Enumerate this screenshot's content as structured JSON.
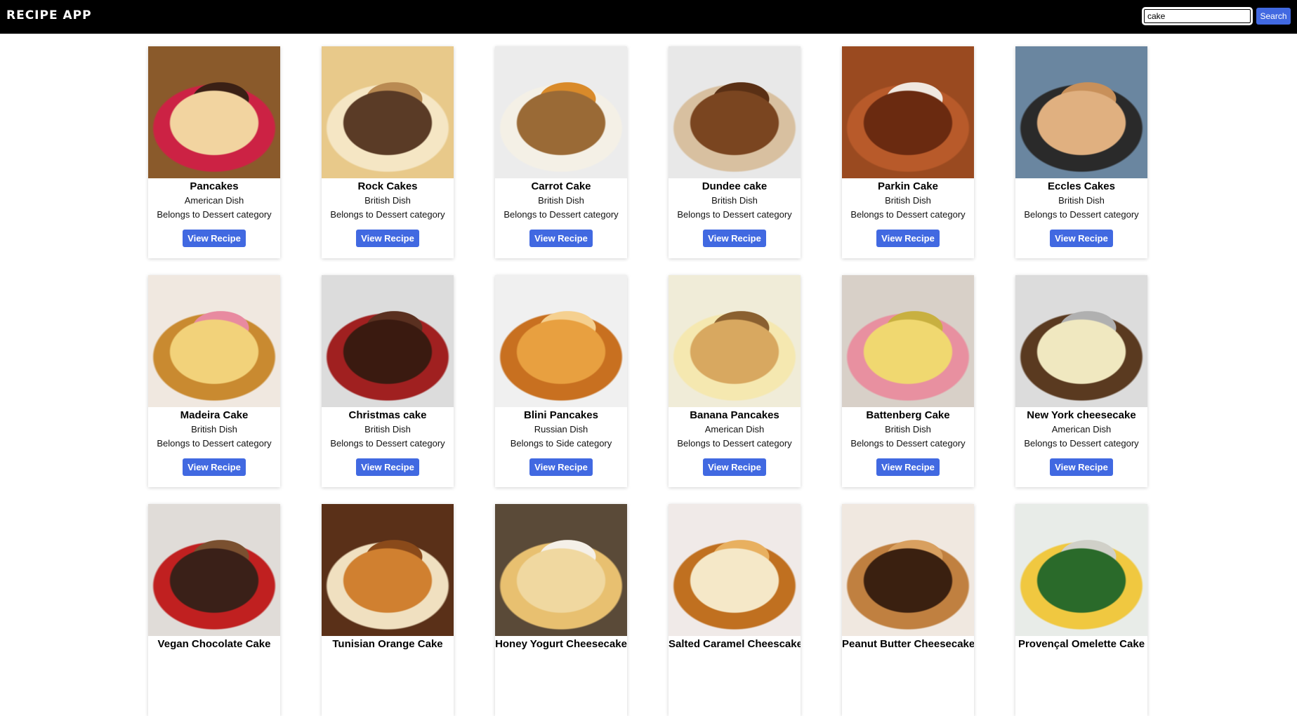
{
  "header": {
    "title": "RECIPE APP",
    "search_value": "cake",
    "search_button": "Search"
  },
  "recipes": [
    {
      "name": "Pancakes",
      "cuisine": "American Dish",
      "category": "Belongs to Dessert category",
      "button": "View Recipe",
      "colors": [
        "#8a5a2b",
        "#f2d4a0",
        "#c24",
        "#3a2015"
      ]
    },
    {
      "name": "Rock Cakes",
      "cuisine": "British Dish",
      "category": "Belongs to Dessert category",
      "button": "View Recipe",
      "colors": [
        "#e8c98a",
        "#5a3b26",
        "#f5e6c4",
        "#b98a52"
      ]
    },
    {
      "name": "Carrot Cake",
      "cuisine": "British Dish",
      "category": "Belongs to Dessert category",
      "button": "View Recipe",
      "colors": [
        "#ececec",
        "#9a6a36",
        "#f4f0e6",
        "#d98a2a"
      ]
    },
    {
      "name": "Dundee cake",
      "cuisine": "British Dish",
      "category": "Belongs to Dessert category",
      "button": "View Recipe",
      "colors": [
        "#e8e8e8",
        "#7a4520",
        "#d8c0a0",
        "#5a3015"
      ]
    },
    {
      "name": "Parkin Cake",
      "cuisine": "British Dish",
      "category": "Belongs to Dessert category",
      "button": "View Recipe",
      "colors": [
        "#9a4a20",
        "#6a2a10",
        "#b85a2a",
        "#f0e8e0"
      ]
    },
    {
      "name": "Eccles Cakes",
      "cuisine": "British Dish",
      "category": "Belongs to Dessert category",
      "button": "View Recipe",
      "colors": [
        "#6a86a0",
        "#e0b080",
        "#2a2a2a",
        "#c8905a"
      ]
    },
    {
      "name": "Madeira Cake",
      "cuisine": "British Dish",
      "category": "Belongs to Dessert category",
      "button": "View Recipe",
      "colors": [
        "#f0e8e0",
        "#f2d27a",
        "#c98a30",
        "#e88aa0"
      ]
    },
    {
      "name": "Christmas cake",
      "cuisine": "British Dish",
      "category": "Belongs to Dessert category",
      "button": "View Recipe",
      "colors": [
        "#dcdcdc",
        "#3a1a10",
        "#a02020",
        "#5a3020"
      ]
    },
    {
      "name": "Blini Pancakes",
      "cuisine": "Russian Dish",
      "category": "Belongs to Side category",
      "button": "View Recipe",
      "colors": [
        "#f0f0f0",
        "#e8a040",
        "#c87020",
        "#f5d090"
      ]
    },
    {
      "name": "Banana Pancakes",
      "cuisine": "American Dish",
      "category": "Belongs to Dessert category",
      "button": "View Recipe",
      "colors": [
        "#f0ecd8",
        "#d8a860",
        "#f5e8b0",
        "#8a6030"
      ]
    },
    {
      "name": "Battenberg Cake",
      "cuisine": "British Dish",
      "category": "Belongs to Dessert category",
      "button": "View Recipe",
      "colors": [
        "#d8d0c8",
        "#f0d870",
        "#e890a0",
        "#c8b040"
      ]
    },
    {
      "name": "New York cheesecake",
      "cuisine": "American Dish",
      "category": "Belongs to Dessert category",
      "button": "View Recipe",
      "colors": [
        "#dcdcdc",
        "#f0e8c0",
        "#5a3a20",
        "#b0b0b0"
      ]
    },
    {
      "name": "Vegan Chocolate Cake",
      "cuisine": "",
      "category": "",
      "button": "",
      "colors": [
        "#e0dcd8",
        "#3a2018",
        "#c02020",
        "#7a5030"
      ]
    },
    {
      "name": "Tunisian Orange Cake",
      "cuisine": "",
      "category": "",
      "button": "",
      "colors": [
        "#5a3018",
        "#d08030",
        "#f0e0c0",
        "#8a4a1a"
      ]
    },
    {
      "name": "Honey Yogurt Cheesecake",
      "cuisine": "",
      "category": "",
      "button": "",
      "colors": [
        "#5a4a38",
        "#f0d8a0",
        "#e8c070",
        "#f5f0e8"
      ]
    },
    {
      "name": "Salted Caramel Cheescake",
      "cuisine": "",
      "category": "",
      "button": "",
      "colors": [
        "#f0eae8",
        "#f5e8c8",
        "#c07020",
        "#e8b060"
      ]
    },
    {
      "name": "Peanut Butter Cheesecake",
      "cuisine": "",
      "category": "",
      "button": "",
      "colors": [
        "#f0e8e0",
        "#3a2010",
        "#c08040",
        "#d8a060"
      ]
    },
    {
      "name": "Provençal Omelette Cake",
      "cuisine": "",
      "category": "",
      "button": "",
      "colors": [
        "#e8ece8",
        "#2a6a2a",
        "#f0c840",
        "#d0d0c8"
      ]
    }
  ]
}
